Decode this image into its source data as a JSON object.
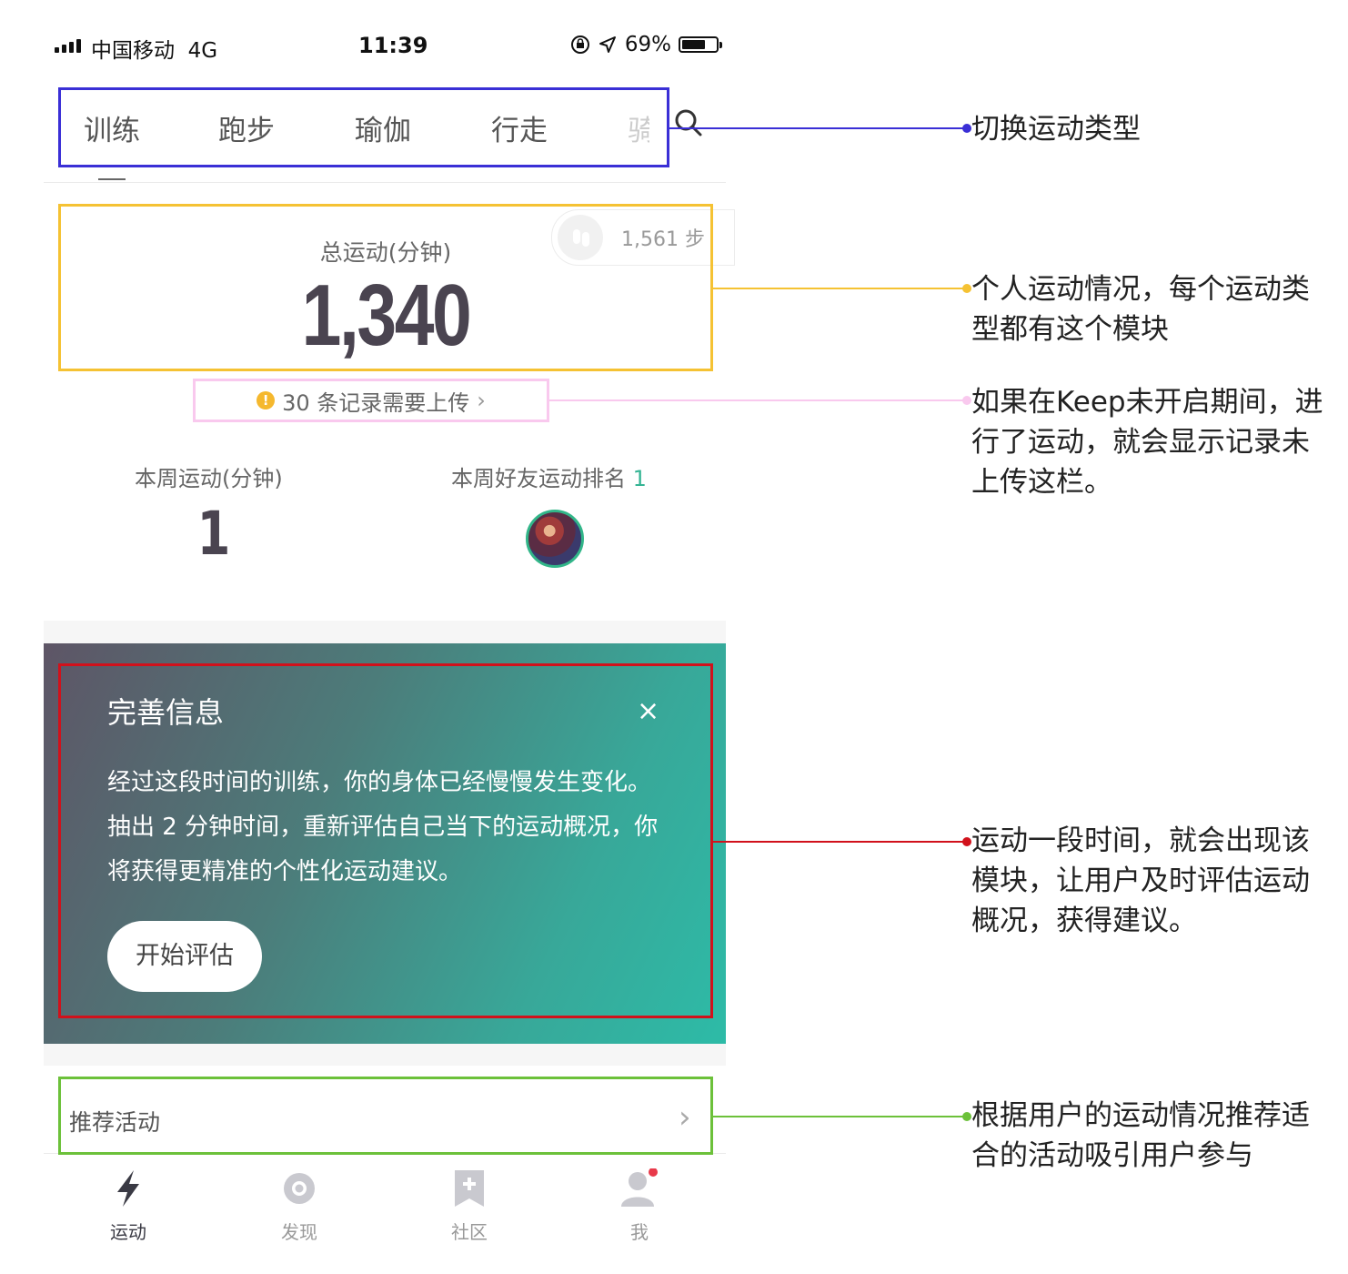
{
  "status_bar": {
    "carrier": "中国移动",
    "network": "4G",
    "time": "11:39",
    "battery": "69%",
    "battery_level": 0.69
  },
  "tabs": [
    "训练",
    "跑步",
    "瑜伽",
    "行走",
    "骑"
  ],
  "stats": {
    "total_label": "总运动(分钟)",
    "total_value": "1,340",
    "steps": "1,561 步",
    "upload_notice": "30 条记录需要上传",
    "week_label": "本周运动(分钟)",
    "week_value": "1",
    "friend_rank_label": "本周好友运动排名",
    "friend_rank_value": "1"
  },
  "promo": {
    "title": "完善信息",
    "close": "×",
    "body": "经过这段时间的训练，你的身体已经慢慢发生变化。抽出 2 分钟时间，重新评估自己当下的运动概况，你将获得更精准的个性化运动建议。",
    "button": "开始评估"
  },
  "recommend": {
    "label": "推荐活动",
    "chevron": "›"
  },
  "tabbar": [
    {
      "label": "运动",
      "icon": "lightning-icon",
      "active": true
    },
    {
      "label": "发现",
      "icon": "discover-icon",
      "active": false
    },
    {
      "label": "社区",
      "icon": "bookmark-plus-icon",
      "active": false
    },
    {
      "label": "我",
      "icon": "user-icon",
      "active": false
    }
  ],
  "annotations": [
    {
      "text": "切换运动类型",
      "color": "#3a2fd6"
    },
    {
      "text": "个人运动情况，每个运动类型都有这个模块",
      "color": "#f5c233"
    },
    {
      "text": "如果在Keep未开启期间，进行了运动，就会显示记录未上传这栏。",
      "color": "#f9c9ee"
    },
    {
      "text": "运动一段时间，就会出现该模块，让用户及时评估运动概况，获得建议。",
      "color": "#d1111b"
    },
    {
      "text": "根据用户的运动情况推荐适合的活动吸引用户参与",
      "color": "#6cc13a"
    }
  ],
  "colors": {
    "accent_green": "#35b494",
    "badge_red": "#e8394a",
    "warning": "#f5b82e"
  }
}
